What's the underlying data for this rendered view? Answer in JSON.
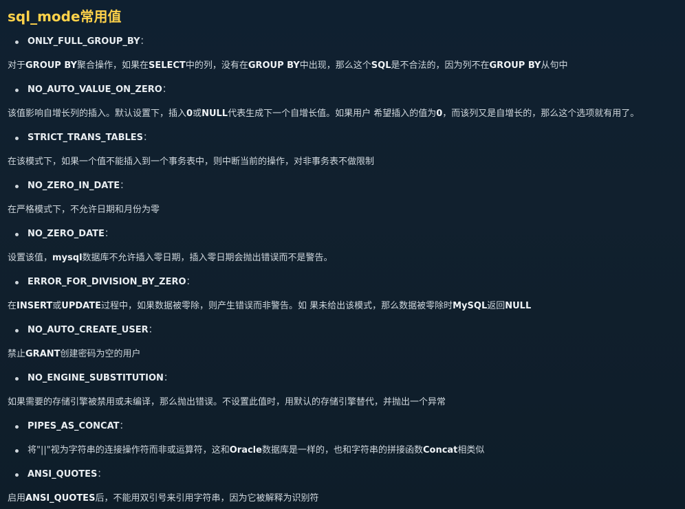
{
  "title": "sql_mode常用值",
  "items": [
    {
      "key": "ONLY_FULL_GROUP_BY",
      "desc": [
        "对于",
        "GROUP BY",
        "聚合操作，如果在",
        "SELECT",
        "中的列，没有在",
        "GROUP BY",
        "中出现，那么这个",
        "SQL",
        "是不合法的，因为列不在",
        "GROUP BY",
        "从句中"
      ]
    },
    {
      "key": "NO_AUTO_VALUE_ON_ZERO",
      "desc": [
        "该值影响自增长列的插入。默认设置下，插入",
        "0",
        "或",
        "NULL",
        "代表生成下一个自增长值。如果用户 希望插入的值为",
        "0",
        "，而该列又是自增长的，那么这个选项就有用了。",
        "",
        ""
      ]
    },
    {
      "key": "STRICT_TRANS_TABLES",
      "desc": [
        "在该模式下，如果一个值不能插入到一个事务表中，则中断当前的操作，对非事务表不做限制"
      ]
    },
    {
      "key": "NO_ZERO_IN_DATE",
      "desc": [
        "在严格模式下，不允许日期和月份为零"
      ]
    },
    {
      "key": "NO_ZERO_DATE",
      "desc": [
        "设置该值，",
        "mysql",
        "数据库不允许插入零日期，插入零日期会抛出错误而不是警告。"
      ]
    },
    {
      "key": "ERROR_FOR_DIVISION_BY_ZERO",
      "desc": [
        "在",
        "INSERT",
        "或",
        "UPDATE",
        "过程中，如果数据被零除，则产生错误而非警告。如 果未给出该模式，那么数据被零除时",
        "MySQL",
        "返回",
        "NULL"
      ]
    },
    {
      "key": "NO_AUTO_CREATE_USER",
      "desc": [
        "禁止",
        "GRANT",
        "创建密码为空的用户"
      ]
    },
    {
      "key": "NO_ENGINE_SUBSTITUTION",
      "desc": [
        "如果需要的存储引擎被禁用或未编译，那么抛出错误。不设置此值时，用默认的存储引擎替代，并抛出一个异常"
      ]
    },
    {
      "key": "PIPES_AS_CONCAT",
      "bullet_desc": [
        "将\"||\"视为字符串的连接操作符而非或运算符，这和",
        "Oracle",
        "数据库是一样的，也和字符串的拼接函数",
        "Concat",
        "相类似"
      ]
    },
    {
      "key": "ANSI_QUOTES",
      "desc": [
        "启用",
        "ANSI_QUOTES",
        "后，不能用双引号来引用字符串，因为它被解释为识别符"
      ]
    }
  ],
  "separator": "："
}
